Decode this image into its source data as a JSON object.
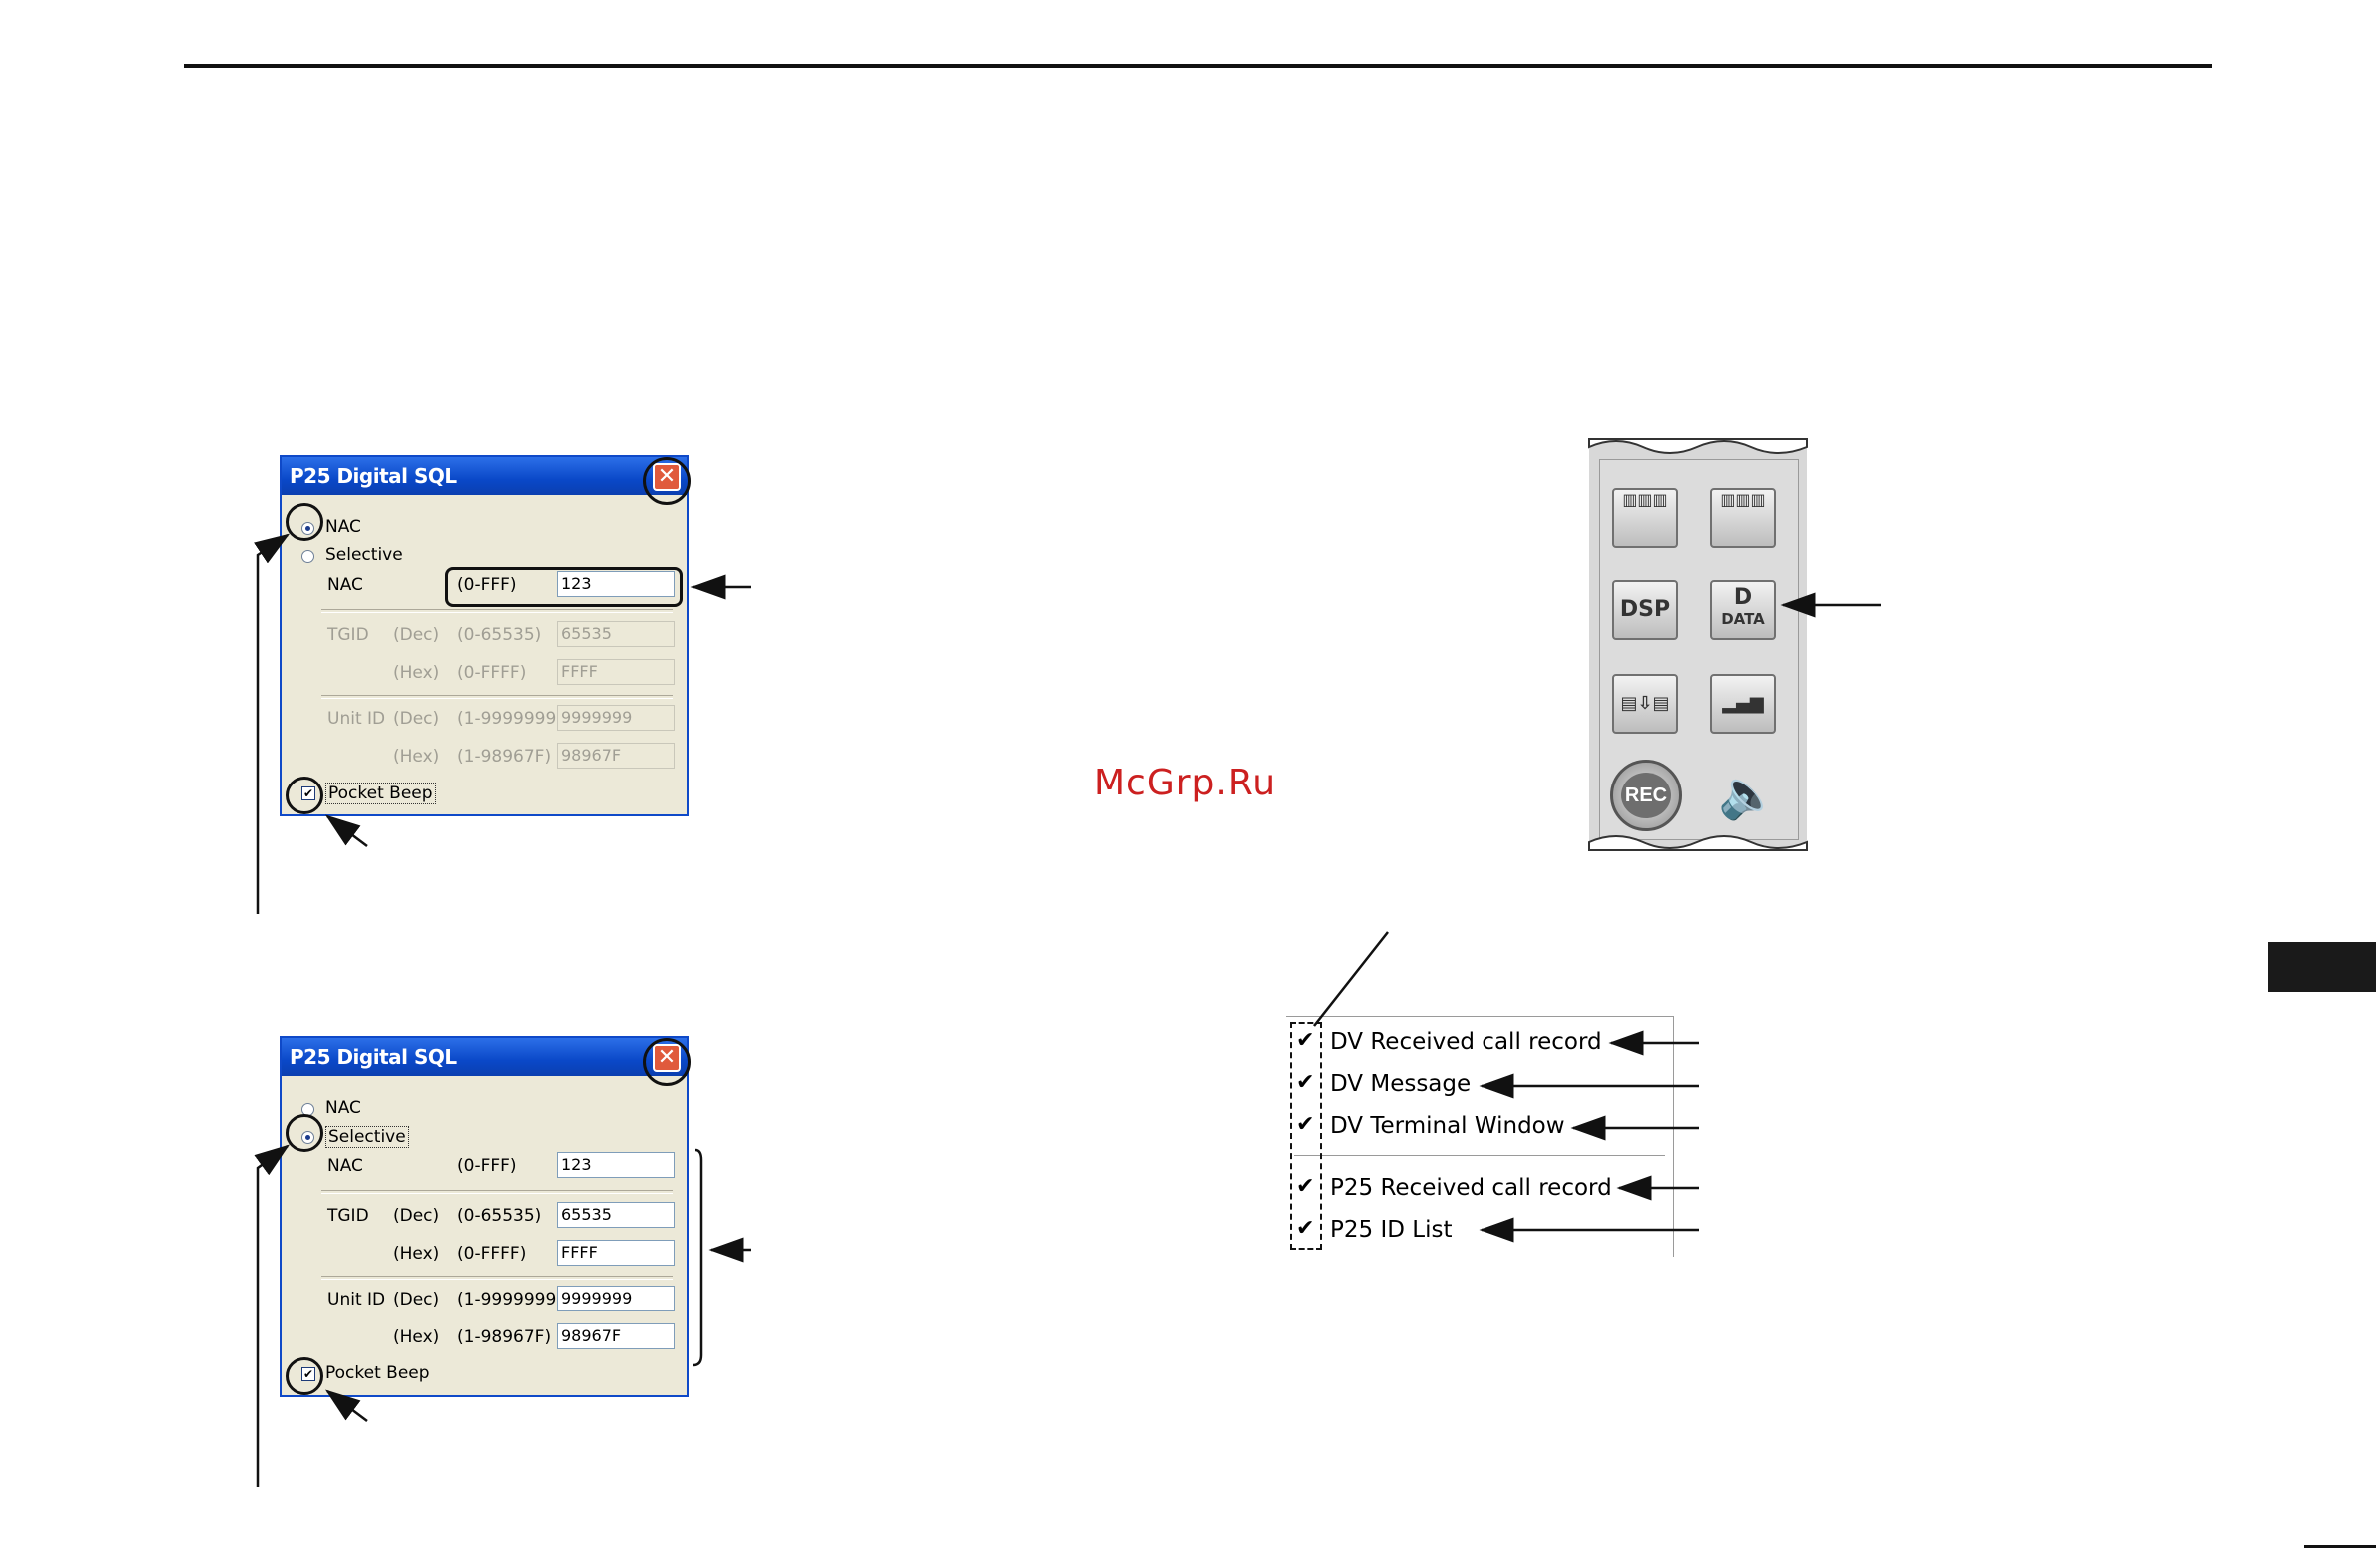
{
  "watermark": "McGrp.Ru",
  "dialog_top": {
    "title": "P25 Digital SQL",
    "close_label": "✕",
    "radio_nac": "NAC",
    "radio_selective": "Selective",
    "nac_label": "NAC",
    "nac_range": "(0-FFF)",
    "nac_value": "123",
    "tgid_label": "TGID",
    "dec_label": "(Dec)",
    "tgid_dec_range": "(0-65535)",
    "tgid_dec_value": "65535",
    "hex_label": "(Hex)",
    "tgid_hex_range": "(0-FFFF)",
    "tgid_hex_value": "FFFF",
    "unitid_label": "Unit ID",
    "unit_dec_range": "(1-9999999)",
    "unit_dec_value": "9999999",
    "unit_hex_range": "(1-98967F)",
    "unit_hex_value": "98967F",
    "pocket_beep": "Pocket Beep",
    "selected": "NAC"
  },
  "dialog_bottom": {
    "title": "P25 Digital SQL",
    "close_label": "✕",
    "radio_nac": "NAC",
    "radio_selective": "Selective",
    "nac_label": "NAC",
    "nac_range": "(0-FFF)",
    "nac_value": "123",
    "tgid_label": "TGID",
    "dec_label": "(Dec)",
    "tgid_dec_range": "(0-65535)",
    "tgid_dec_value": "65535",
    "hex_label": "(Hex)",
    "tgid_hex_range": "(0-FFFF)",
    "tgid_hex_value": "FFFF",
    "unitid_label": "Unit ID",
    "unit_dec_range": "(1-9999999)",
    "unit_dec_value": "9999999",
    "unit_hex_range": "(1-98967F)",
    "unit_hex_value": "98967F",
    "pocket_beep": "Pocket Beep",
    "selected": "Selective"
  },
  "toolbar": {
    "dsp_label": "DSP",
    "data_letter": "D",
    "data_label": "DATA",
    "rec_label": "REC"
  },
  "menu": {
    "items": [
      "DV Received call record",
      "DV Message",
      "DV Terminal Window",
      "P25 Received call record",
      "P25 ID List"
    ],
    "check_glyph": "✔"
  }
}
